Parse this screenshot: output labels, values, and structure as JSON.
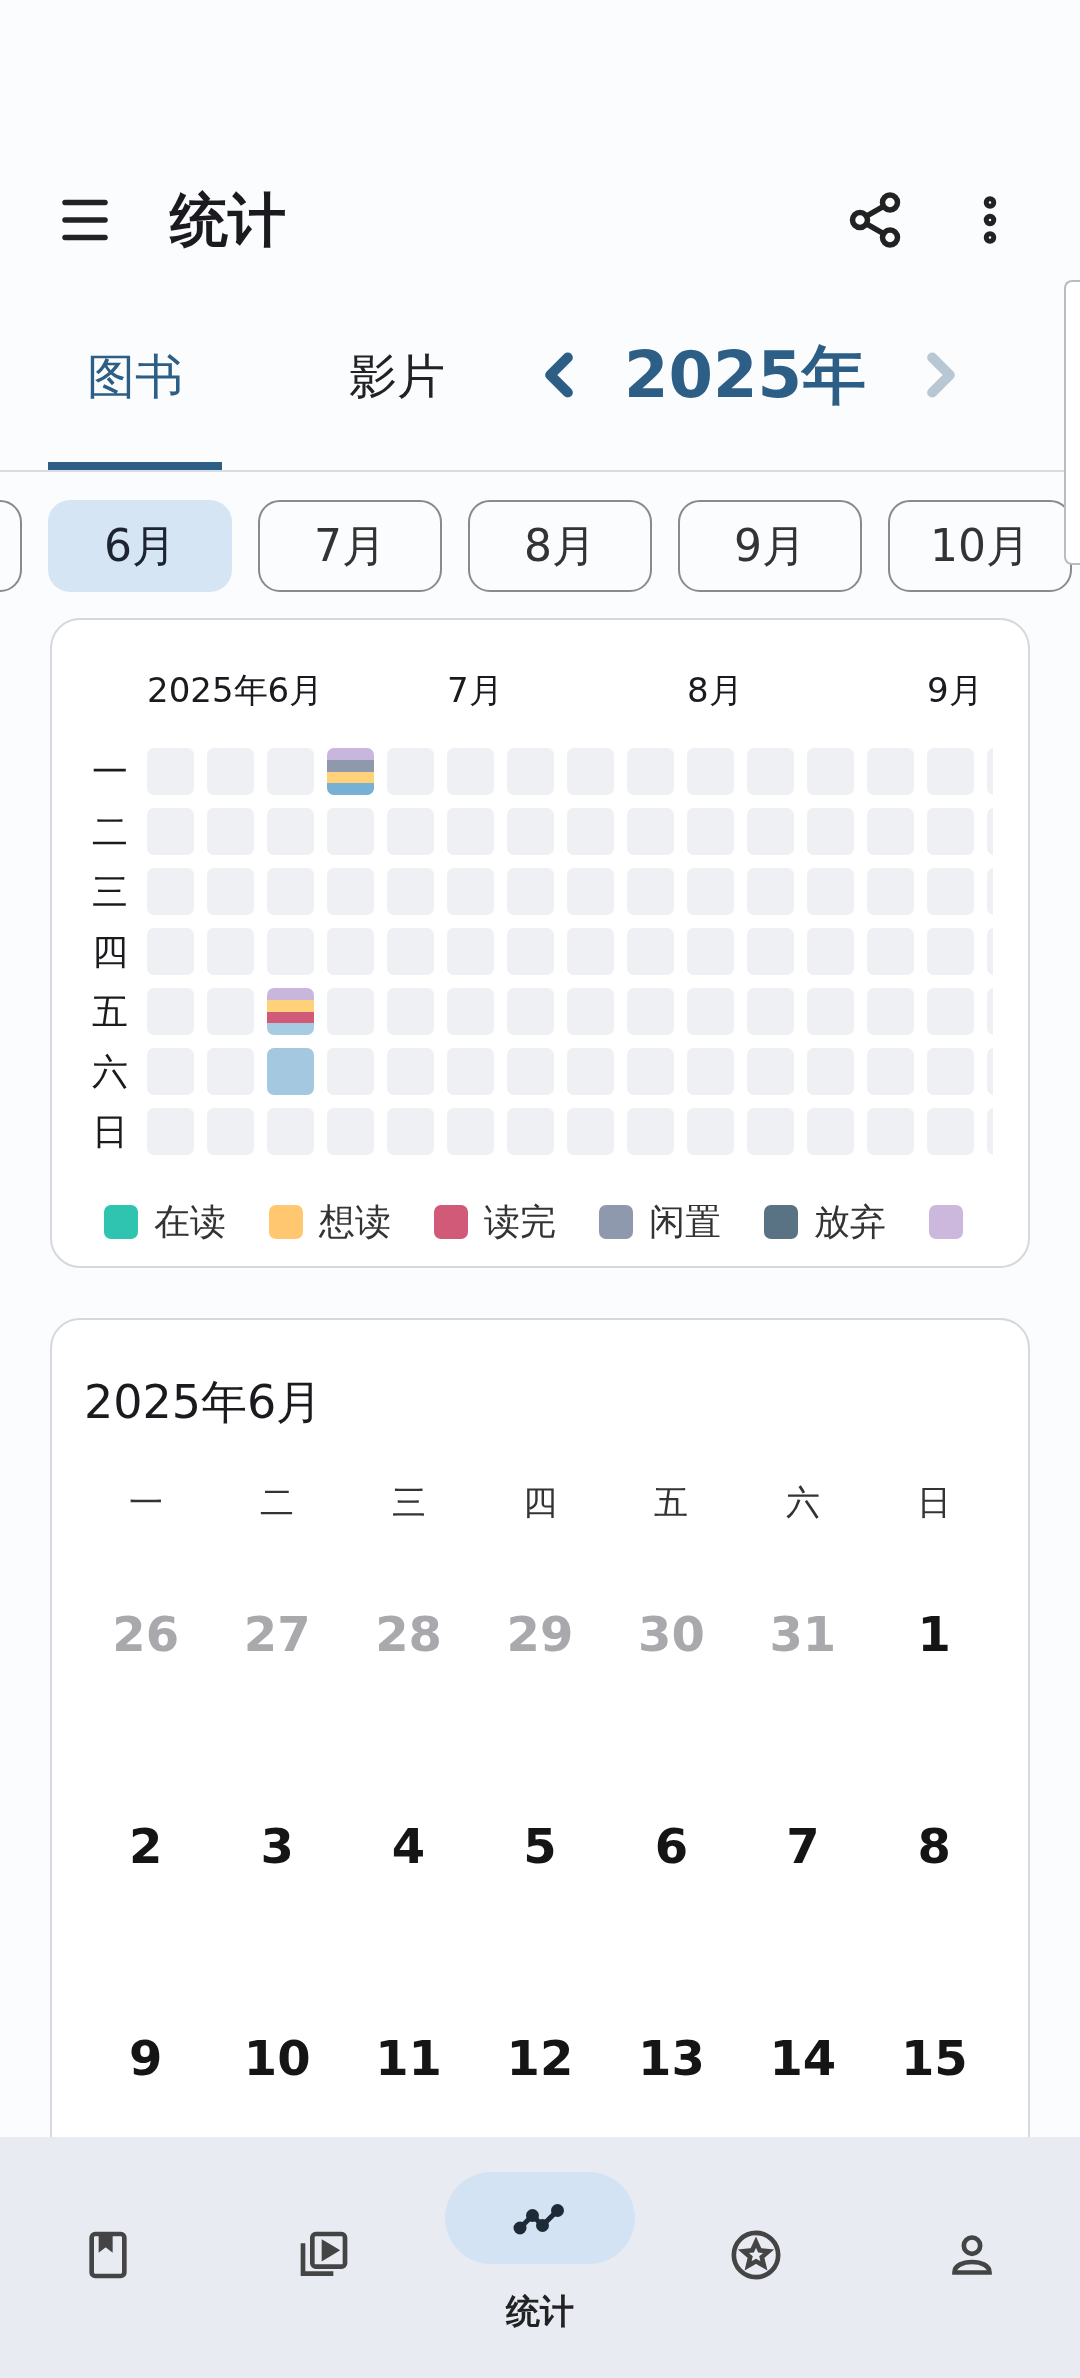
{
  "app_bar": {
    "title": "统计"
  },
  "tabs": [
    {
      "label": "图书",
      "selected": true
    },
    {
      "label": "影片",
      "selected": false
    }
  ],
  "year_nav": {
    "label": "2025年",
    "prev_disabled": false,
    "next_disabled": true
  },
  "month_chips": [
    {
      "selected": false
    },
    {
      "label": "6月",
      "selected": true
    },
    {
      "label": "7月",
      "selected": false
    },
    {
      "label": "8月",
      "selected": false
    },
    {
      "label": "9月",
      "selected": false
    },
    {
      "label": "10月",
      "selected": false
    }
  ],
  "heatmap": {
    "month_labels": [
      "2025年6月",
      "7月",
      "8月",
      "9月"
    ],
    "rows": [
      {
        "label": "一",
        "cells": [
          {},
          {},
          {},
          {
            "segments": [
              {
                "color": "#c9b6dc"
              },
              {
                "color": "#8e99ae"
              },
              {
                "color": "#ffd27a"
              },
              {
                "color": "#76b0d3"
              }
            ]
          },
          {},
          {},
          {},
          {},
          {},
          {},
          {},
          {},
          {},
          {},
          {}
        ]
      },
      {
        "label": "二",
        "cells": [
          {},
          {},
          {},
          {},
          {},
          {},
          {},
          {},
          {},
          {},
          {},
          {},
          {},
          {},
          {}
        ]
      },
      {
        "label": "三",
        "cells": [
          {},
          {},
          {},
          {},
          {},
          {},
          {},
          {},
          {},
          {},
          {},
          {},
          {},
          {},
          {}
        ]
      },
      {
        "label": "四",
        "cells": [
          {},
          {},
          {},
          {},
          {},
          {},
          {},
          {},
          {},
          {},
          {},
          {},
          {},
          {},
          {}
        ]
      },
      {
        "label": "五",
        "cells": [
          {},
          {},
          {
            "segments": [
              {
                "color": "#c9b6dc"
              },
              {
                "color": "#ffd27a"
              },
              {
                "color": "#d05a78"
              },
              {
                "color": "#a7cbe0"
              }
            ]
          },
          {},
          {},
          {},
          {},
          {},
          {},
          {},
          {},
          {},
          {},
          {},
          {}
        ]
      },
      {
        "label": "六",
        "cells": [
          {},
          {},
          {
            "segments": [
              {
                "color": "#a3c8df"
              }
            ]
          },
          {},
          {},
          {},
          {},
          {},
          {},
          {},
          {},
          {},
          {},
          {},
          {}
        ]
      },
      {
        "label": "日",
        "cells": [
          {},
          {},
          {},
          {},
          {},
          {},
          {},
          {},
          {},
          {},
          {},
          {},
          {},
          {},
          {}
        ]
      }
    ],
    "legend": [
      {
        "label": "在读",
        "color": "#2ec4b0"
      },
      {
        "label": "想读",
        "color": "#ffc870"
      },
      {
        "label": "读完",
        "color": "#d05a78"
      },
      {
        "label": "闲置",
        "color": "#8e99ae"
      },
      {
        "label": "放弃",
        "color": "#5a7384"
      },
      {
        "color": "#cdb8dd"
      }
    ]
  },
  "calendar": {
    "title": "2025年6月",
    "weekdays": [
      "一",
      "二",
      "三",
      "四",
      "五",
      "六",
      "日"
    ],
    "weeks": [
      [
        {
          "day": "26",
          "muted": true
        },
        {
          "day": "27",
          "muted": true
        },
        {
          "day": "28",
          "muted": true
        },
        {
          "day": "29",
          "muted": true
        },
        {
          "day": "30",
          "muted": true
        },
        {
          "day": "31",
          "muted": true
        },
        {
          "day": "1",
          "muted": false
        }
      ],
      [
        {
          "day": "2",
          "muted": false
        },
        {
          "day": "3",
          "muted": false
        },
        {
          "day": "4",
          "muted": false
        },
        {
          "day": "5",
          "muted": false
        },
        {
          "day": "6",
          "muted": false
        },
        {
          "day": "7",
          "muted": false
        },
        {
          "day": "8",
          "muted": false
        }
      ],
      [
        {
          "day": "9",
          "muted": false
        },
        {
          "day": "10",
          "muted": false
        },
        {
          "day": "11",
          "muted": false
        },
        {
          "day": "12",
          "muted": false
        },
        {
          "day": "13",
          "muted": false
        },
        {
          "day": "14",
          "muted": false
        },
        {
          "day": "15",
          "muted": false
        }
      ]
    ]
  },
  "bottom_nav": [
    {
      "kind": "books",
      "selected": false
    },
    {
      "kind": "videos",
      "selected": false
    },
    {
      "kind": "stats",
      "selected": true,
      "label": "统计"
    },
    {
      "kind": "favorites",
      "selected": false
    },
    {
      "kind": "profile",
      "selected": false
    }
  ]
}
